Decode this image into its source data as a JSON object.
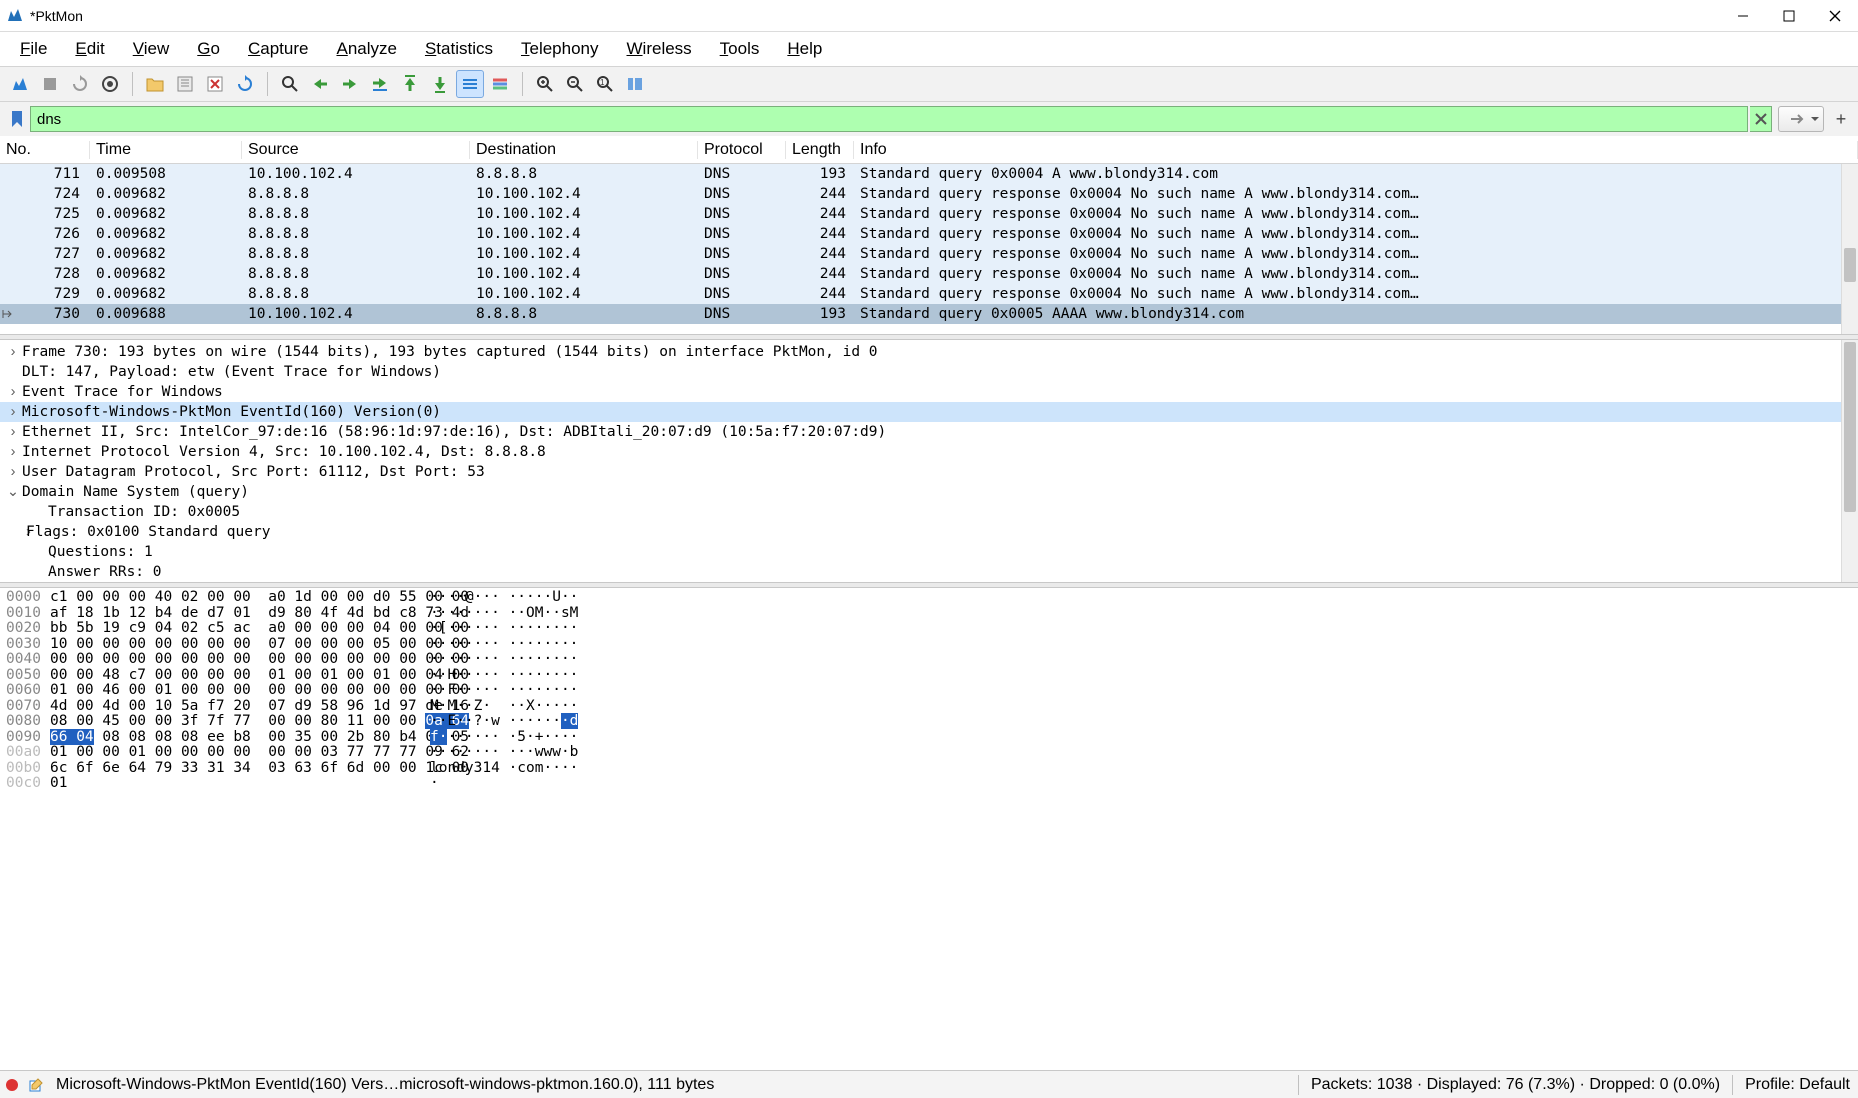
{
  "title": "*PktMon",
  "menu": [
    "File",
    "Edit",
    "View",
    "Go",
    "Capture",
    "Analyze",
    "Statistics",
    "Telephony",
    "Wireless",
    "Tools",
    "Help"
  ],
  "filter": {
    "value": "dns"
  },
  "columns": [
    "No.",
    "Time",
    "Source",
    "Destination",
    "Protocol",
    "Length",
    "Info"
  ],
  "packets": [
    {
      "no": "711",
      "time": "0.009508",
      "src": "10.100.102.4",
      "dst": "8.8.8.8",
      "prot": "DNS",
      "len": "193",
      "info": "Standard query 0x0004 A www.blondy314.com"
    },
    {
      "no": "724",
      "time": "0.009682",
      "src": "8.8.8.8",
      "dst": "10.100.102.4",
      "prot": "DNS",
      "len": "244",
      "info": "Standard query response 0x0004 No such name A www.blondy314.com…"
    },
    {
      "no": "725",
      "time": "0.009682",
      "src": "8.8.8.8",
      "dst": "10.100.102.4",
      "prot": "DNS",
      "len": "244",
      "info": "Standard query response 0x0004 No such name A www.blondy314.com…"
    },
    {
      "no": "726",
      "time": "0.009682",
      "src": "8.8.8.8",
      "dst": "10.100.102.4",
      "prot": "DNS",
      "len": "244",
      "info": "Standard query response 0x0004 No such name A www.blondy314.com…"
    },
    {
      "no": "727",
      "time": "0.009682",
      "src": "8.8.8.8",
      "dst": "10.100.102.4",
      "prot": "DNS",
      "len": "244",
      "info": "Standard query response 0x0004 No such name A www.blondy314.com…"
    },
    {
      "no": "728",
      "time": "0.009682",
      "src": "8.8.8.8",
      "dst": "10.100.102.4",
      "prot": "DNS",
      "len": "244",
      "info": "Standard query response 0x0004 No such name A www.blondy314.com…"
    },
    {
      "no": "729",
      "time": "0.009682",
      "src": "8.8.8.8",
      "dst": "10.100.102.4",
      "prot": "DNS",
      "len": "244",
      "info": "Standard query response 0x0004 No such name A www.blondy314.com…"
    },
    {
      "no": "730",
      "time": "0.009688",
      "src": "10.100.102.4",
      "dst": "8.8.8.8",
      "prot": "DNS",
      "len": "193",
      "info": "Standard query 0x0005 AAAA www.blondy314.com",
      "selected": true
    }
  ],
  "details": [
    {
      "tw": ">",
      "indent": 0,
      "text": "Frame 730: 193 bytes on wire (1544 bits), 193 bytes captured (1544 bits) on interface PktMon, id 0"
    },
    {
      "tw": "",
      "indent": 0,
      "text": "DLT: 147, Payload: etw (Event Trace for Windows)"
    },
    {
      "tw": ">",
      "indent": 0,
      "text": "Event Trace for Windows"
    },
    {
      "tw": ">",
      "indent": 0,
      "text": "Microsoft-Windows-PktMon EventId(160) Version(0)",
      "selected": true
    },
    {
      "tw": ">",
      "indent": 0,
      "text": "Ethernet II, Src: IntelCor_97:de:16 (58:96:1d:97:de:16), Dst: ADBItali_20:07:d9 (10:5a:f7:20:07:d9)"
    },
    {
      "tw": ">",
      "indent": 0,
      "text": "Internet Protocol Version 4, Src: 10.100.102.4, Dst: 8.8.8.8"
    },
    {
      "tw": ">",
      "indent": 0,
      "text": "User Datagram Protocol, Src Port: 61112, Dst Port: 53"
    },
    {
      "tw": "v",
      "indent": 0,
      "text": "Domain Name System (query)"
    },
    {
      "tw": "",
      "indent": 2,
      "text": "Transaction ID: 0x0005"
    },
    {
      "tw": ">",
      "indent": 1,
      "text": "Flags: 0x0100 Standard query"
    },
    {
      "tw": "",
      "indent": 2,
      "text": "Questions: 1"
    },
    {
      "tw": "",
      "indent": 2,
      "text": "Answer RRs: 0"
    }
  ],
  "hex": [
    {
      "off": "0000",
      "b": "c1 00 00 00 40 02 00 00  a0 1d 00 00 d0 55 00 00",
      "a": "····@··· ·····U··"
    },
    {
      "off": "0010",
      "b": "af 18 1b 12 b4 de d7 01  d9 80 4f 4d bd c8 73 4d",
      "a": "········ ··OM··sM"
    },
    {
      "off": "0020",
      "b": "bb 5b 19 c9 04 02 c5 ac  a0 00 00 00 04 00 00 00",
      "a": "·[······ ········"
    },
    {
      "off": "0030",
      "b": "10 00 00 00 00 00 00 00  07 00 00 00 05 00 00 00",
      "a": "········ ········"
    },
    {
      "off": "0040",
      "b": "00 00 00 00 00 00 00 00  00 00 00 00 00 00 00 00",
      "a": "········ ········"
    },
    {
      "off": "0050",
      "b": "00 00 48 c7 00 00 00 00  01 00 01 00 01 00 04 00",
      "a": "··H····· ········"
    },
    {
      "off": "0060",
      "b": "01 00 46 00 01 00 00 00  00 00 00 00 00 00 00 00",
      "a": "··F····· ········"
    },
    {
      "off": "0070",
      "b": "4d 00 4d 00 10 5a f7 20  07 d9 58 96 1d 97 de 16",
      "a": "M·M··Z·  ··X·····"
    },
    {
      "off": "0080",
      "b": "08 00 45 00 00 3f 7f 77  00 00 80 11 00 00 ",
      "a": "··E··?·w ······",
      "hl_b": "0a 64",
      "hl_a": "·d"
    },
    {
      "off": "0090",
      "b_pre_hl": "66 04",
      "b": " 08 08 08 08 ee b8  00 35 00 2b 80 b4 00 05",
      "a_pre_hl": "f·",
      "a": "······ ·5·+····"
    },
    {
      "off": "00a0",
      "b": "01 00 00 01 00 00 00 00  00 00 03 77 77 77 09 62",
      "a": "········ ···www·b",
      "faded": true
    },
    {
      "off": "00b0",
      "b": "6c 6f 6e 64 79 33 31 34  03 63 6f 6d 00 00 1c 00",
      "a": "londy314 ·com····",
      "faded": true
    },
    {
      "off": "00c0",
      "b": "01",
      "a": "·",
      "faded": true
    }
  ],
  "status": {
    "seg1": "Microsoft-Windows-PktMon EventId(160) Vers…microsoft-windows-pktmon.160.0), 111 bytes",
    "seg2": "Packets: 1038 · Displayed: 76 (7.3%) · Dropped: 0 (0.0%)",
    "seg3": "Profile: Default"
  }
}
